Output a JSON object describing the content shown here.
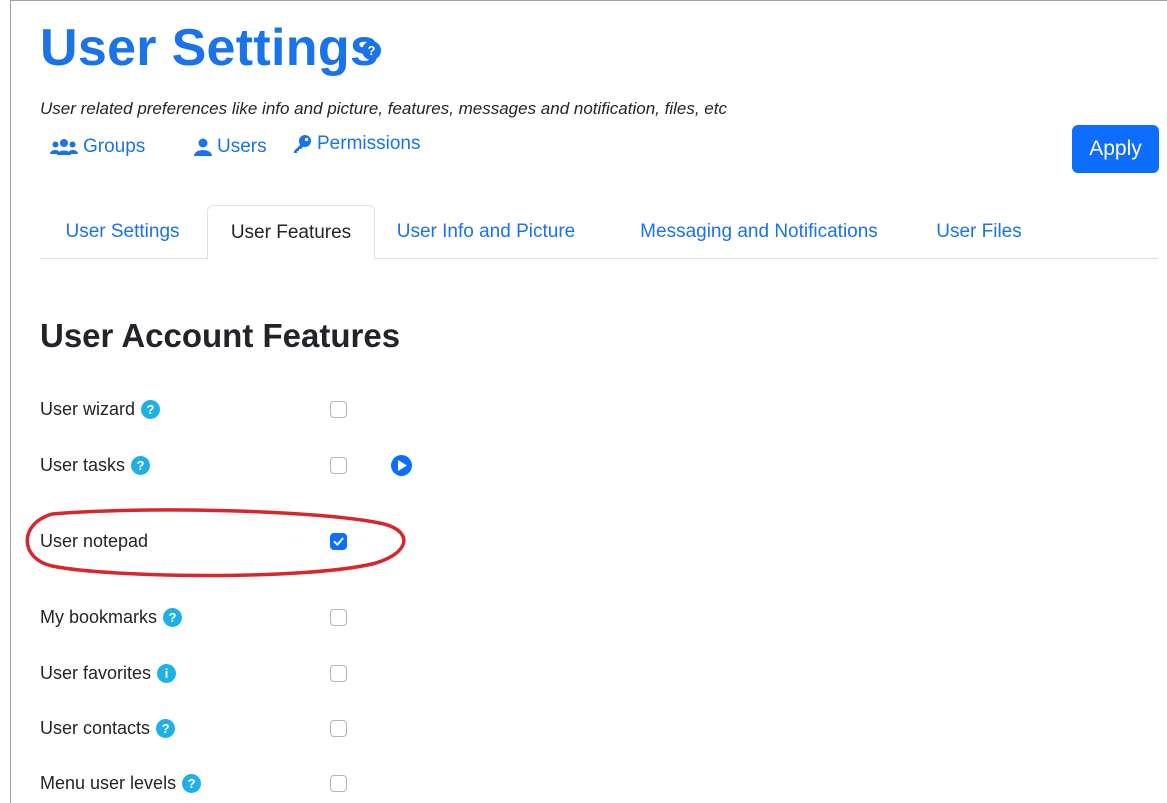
{
  "header": {
    "title": "User Settings",
    "title_help_symbol": "?",
    "subtitle": "User related preferences like info and picture, features, messages and notification, files, etc",
    "links": [
      {
        "label": "Groups",
        "icon": "users-group-icon"
      },
      {
        "label": "Users",
        "icon": "user-icon"
      },
      {
        "label": "Permissions",
        "icon": "key-icon"
      }
    ],
    "apply_label": "Apply"
  },
  "tabs": [
    {
      "label": "User Settings",
      "active": false
    },
    {
      "label": "User Features",
      "active": true
    },
    {
      "label": "User Info and Picture",
      "active": false
    },
    {
      "label": "Messaging and Notifications",
      "active": false
    },
    {
      "label": "User Files",
      "active": false
    }
  ],
  "section": {
    "heading": "User Account Features",
    "features": [
      {
        "label": "User wizard",
        "help": "?",
        "checked": false
      },
      {
        "label": "User tasks",
        "help": "?",
        "checked": false,
        "play_icon": "play-circle-icon"
      },
      {
        "label": "User notepad",
        "help": "",
        "checked": true,
        "highlighted": true
      },
      {
        "label": "My bookmarks",
        "help": "?",
        "checked": false
      },
      {
        "label": "User favorites",
        "help": "i",
        "checked": false
      },
      {
        "label": "User contacts",
        "help": "?",
        "checked": false
      },
      {
        "label": "Menu user levels",
        "help": "?",
        "checked": false
      }
    ]
  },
  "colors": {
    "primary": "#1a73e8",
    "button": "#0d6efd",
    "help_badge": "#1fb1e6",
    "annotation": "#d9262c"
  }
}
